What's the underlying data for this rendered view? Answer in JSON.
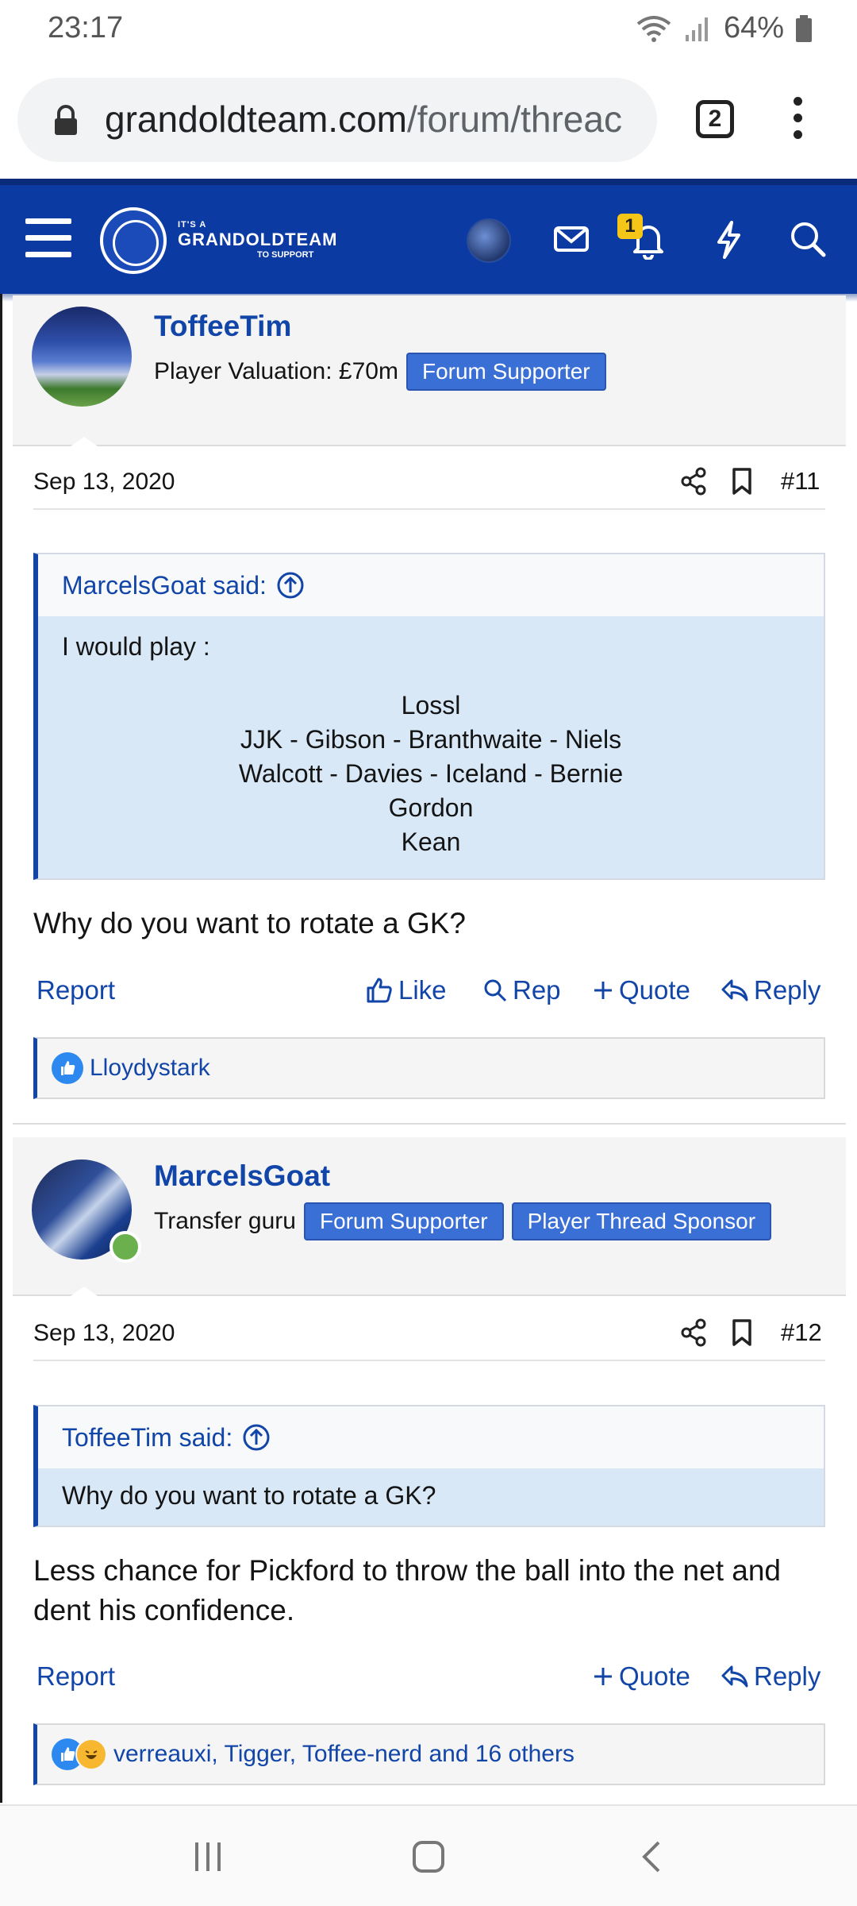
{
  "status_bar": {
    "time": "23:17",
    "battery": "64%"
  },
  "browser": {
    "url_host": "grandoldteam.com",
    "url_path": "/forum/threac",
    "tab_count": "2"
  },
  "forum_header": {
    "logo_small": "IT'S A",
    "logo_big": "GRANDOLDTEAM",
    "logo_small2": "TO SUPPORT",
    "alert_count": "1"
  },
  "posts": [
    {
      "username": "ToffeeTim",
      "user_title": "Player Valuation: £70m",
      "banners": [
        "Forum Supporter"
      ],
      "date": "Sep 13, 2020",
      "post_number": "#11",
      "quote": {
        "attribution": "MarcelsGoat said:",
        "intro": "I would play :",
        "lines": [
          "Lossl",
          "JJK - Gibson - Branthwaite - Niels",
          "Walcott - Davies - Iceland - Bernie",
          "Gordon",
          "Kean"
        ]
      },
      "message": "Why do you want to rotate a GK?",
      "actions": {
        "report": "Report",
        "like": "Like",
        "rep": "Rep",
        "quote": "Quote",
        "reply": "Reply"
      },
      "reactions": "Lloydystark"
    },
    {
      "username": "MarcelsGoat",
      "user_title": "Transfer guru",
      "banners": [
        "Forum Supporter",
        "Player Thread Sponsor"
      ],
      "date": "Sep 13, 2020",
      "post_number": "#12",
      "quote": {
        "attribution": "ToffeeTim said:",
        "text": "Why do you want to rotate a GK?"
      },
      "message": "Less chance for Pickford to throw the ball into the net and dent his confidence.",
      "actions": {
        "report": "Report",
        "quote": "Quote",
        "reply": "Reply"
      },
      "reactions": "verreauxi, Tigger, Toffee-nerd and 16 others"
    }
  ],
  "colors": {
    "header_blue": "#0c3aa3",
    "link_blue": "#1245a8",
    "banner_blue": "#3a6fd6",
    "quote_bg": "#d8e8f7"
  }
}
